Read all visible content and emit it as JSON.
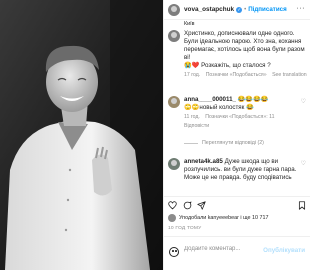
{
  "post": {
    "username": "vova_ostapchuk",
    "follow_label": "Підписатися",
    "location": "Київ",
    "caption": "Христинко, дописнювали одне одного. Були ідеальною парою. Хто зна, кохання перемагає, хотілось щоб вона були разом ві!",
    "caption_emoji": "😭❤️ Розкажіть, що сталося ?",
    "caption_time": "17 год.",
    "caption_likes": "Позначки «Подобається»",
    "caption_translate": "See translation"
  },
  "comments": [
    {
      "username": "anna____000011_",
      "emoji": "😂😂😂😂",
      "text": "🙄🙄новый колостяк 😂",
      "time": "11 год.",
      "likes": "Позначки «Подобається»: 11",
      "reply": "Відповісти",
      "view_replies": "Переглянути відповіді (2)"
    },
    {
      "username": "anneta4k.a85",
      "text": "Дуже шкода що ви розлучились. ви були дуже гарна пара. Може це не правда. буду сподіватись"
    }
  ],
  "actions": {
    "like_icon": "heart-icon",
    "comment_icon": "comment-icon",
    "share_icon": "send-icon",
    "save_icon": "bookmark-icon"
  },
  "likes_line": "Уподобали kanyeeebear і ще 10 717",
  "time_ago": "10 ГОД ТОМУ",
  "add_comment": {
    "placeholder": "Додайте коментар...",
    "publish_label": "Опублікувати"
  }
}
